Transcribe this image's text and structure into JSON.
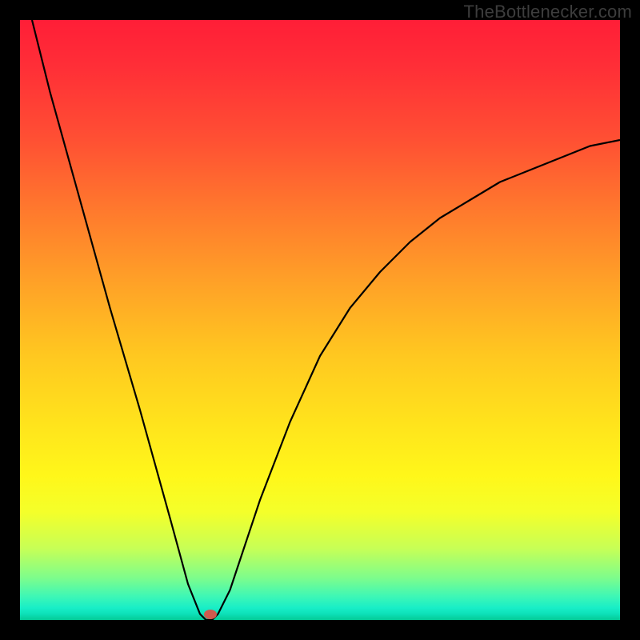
{
  "watermark": "TheBottlenecker.com",
  "colors": {
    "frame": "#000000",
    "curve": "#000000",
    "dot": "#cf5a4e"
  },
  "chart_data": {
    "type": "line",
    "title": "",
    "xlabel": "",
    "ylabel": "",
    "xlim": [
      0,
      100
    ],
    "ylim": [
      0,
      100
    ],
    "gradient_stops": [
      {
        "pct": 0,
        "color": "#ff1e37"
      },
      {
        "pct": 20,
        "color": "#ff5033"
      },
      {
        "pct": 44,
        "color": "#ffa227"
      },
      {
        "pct": 68,
        "color": "#ffe51c"
      },
      {
        "pct": 88,
        "color": "#c8ff55"
      },
      {
        "pct": 100,
        "color": "#04c995"
      }
    ],
    "series": [
      {
        "name": "bottleneck-curve",
        "x": [
          2,
          5,
          10,
          15,
          20,
          25,
          28,
          30,
          31,
          32,
          33,
          35,
          40,
          45,
          50,
          55,
          60,
          65,
          70,
          75,
          80,
          85,
          90,
          95,
          100
        ],
        "y": [
          100,
          88,
          70,
          52,
          35,
          17,
          6,
          1,
          0,
          0,
          1,
          5,
          20,
          33,
          44,
          52,
          58,
          63,
          67,
          70,
          73,
          75,
          77,
          79,
          80
        ]
      }
    ],
    "markers": [
      {
        "name": "optimal-point",
        "x": 31.5,
        "y": 0
      }
    ]
  }
}
